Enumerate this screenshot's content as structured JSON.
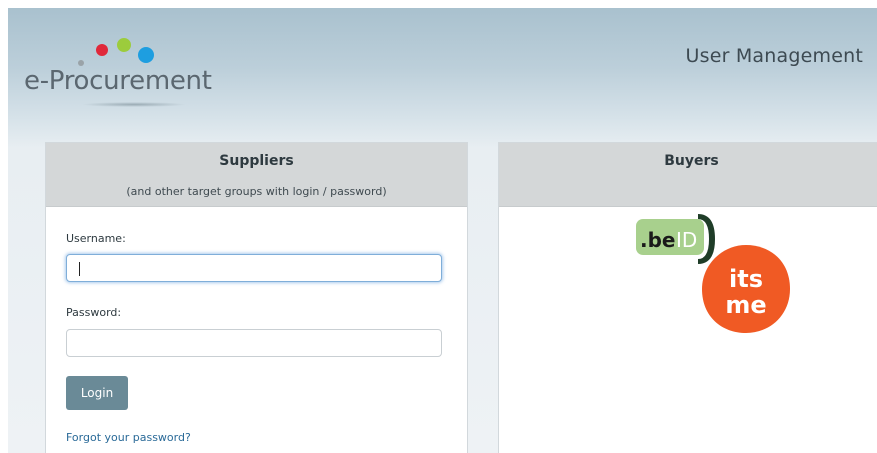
{
  "header": {
    "logo_text": "e-Procurement",
    "app_title": "User Management"
  },
  "suppliers": {
    "title": "Suppliers",
    "subtitle": "(and other target groups with login / password)",
    "username_label": "Username:",
    "username_value": "",
    "password_label": "Password:",
    "password_value": "",
    "login_button": "Login",
    "forgot_link": "Forgot your password?"
  },
  "buyers": {
    "title": "Buyers",
    "beid_logo_text": ".beID",
    "itsme_logo_text": "itsme"
  },
  "colors": {
    "header_gradient_top": "#a9c1ce",
    "panel_header": "#d4d7d8",
    "login_button": "#6a8a97",
    "link": "#2a6a98",
    "beid_green": "#a8d08d",
    "itsme_orange": "#f05a24",
    "logo_dot_red": "#e0283a",
    "logo_dot_green": "#9ccc3c",
    "logo_dot_blue": "#1e9ee0",
    "logo_dot_grey": "#9aa3a8"
  }
}
